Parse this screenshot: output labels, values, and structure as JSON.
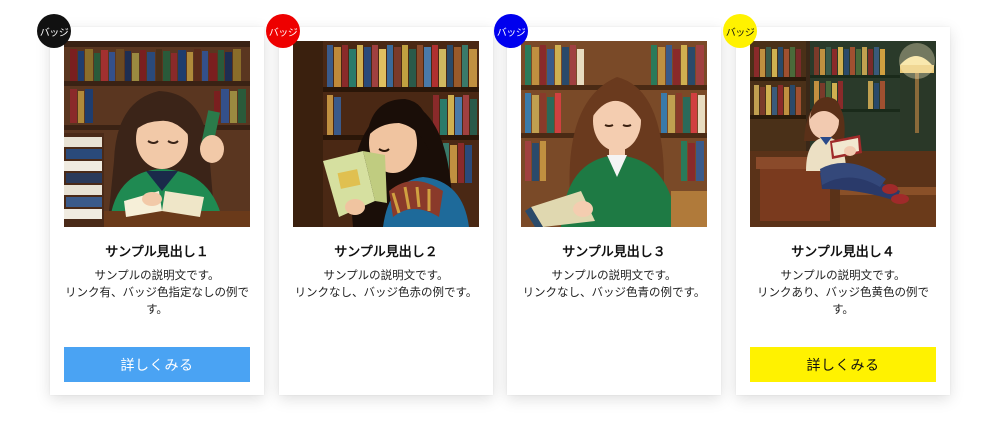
{
  "cards": [
    {
      "badge": {
        "label": "バッジ",
        "bg": "#111111",
        "fg": "#ffffff"
      },
      "title": "サンプル見出し１",
      "desc": [
        "サンプルの説明文です。",
        "リンク有、バッジ色指定なしの例で",
        "す。"
      ],
      "button": {
        "label": "詳しくみる",
        "bg": "#4aa3f3",
        "fg": "#ffffff"
      },
      "image": "girl-reading-books-at-table"
    },
    {
      "badge": {
        "label": "バッジ",
        "bg": "#ee0000",
        "fg": "#ffffff"
      },
      "title": "サンプル見出し２",
      "desc": [
        "サンプルの説明文です。",
        "リンクなし、バッジ色赤の例です。"
      ],
      "image": "girl-reading-book-in-library"
    },
    {
      "badge": {
        "label": "バッジ",
        "bg": "#0000ee",
        "fg": "#ffffff"
      },
      "title": "サンプル見出し３",
      "desc": [
        "サンプルの説明文です。",
        "リンクなし、バッジ色青の例です。"
      ],
      "image": "girl-in-green-cardigan-holding-book"
    },
    {
      "badge": {
        "label": "バッジ",
        "bg": "#fff200",
        "fg": "#111111"
      },
      "title": "サンプル見出し４",
      "desc": [
        "サンプルの説明文です。",
        "リンクあり、バッジ色黄色の例で",
        "す。"
      ],
      "button": {
        "label": "詳しくみる",
        "bg": "#fff200",
        "fg": "#111111"
      },
      "image": "girl-sitting-reading-in-library"
    }
  ]
}
